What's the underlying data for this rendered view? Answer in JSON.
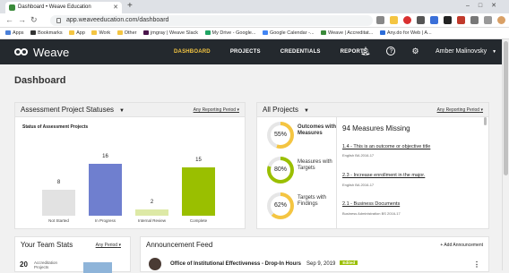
{
  "browser": {
    "tab_title": "Dashboard • Weave Education",
    "url": "app.weaveeducation.com/dashboard",
    "bookmarks": [
      "Apps",
      "Bookmarks",
      "App",
      "Work",
      "Other",
      "jmgray | Weave Slack",
      "My Drive - Google...",
      "Google Calendar -...",
      "Weave | Accreditat...",
      "Any.do for Web | A..."
    ]
  },
  "nav": {
    "logo": "Weave",
    "links": [
      "DASHBOARD",
      "PROJECTS",
      "CREDENTIALS",
      "REPORTS"
    ],
    "user": "Amber Malinovsky"
  },
  "page": {
    "title": "Dashboard"
  },
  "statuses_panel": {
    "title": "Assessment Project Statuses",
    "period": "Any Reporting Period",
    "chart_title": "Status of Assessment Projects"
  },
  "chart_data": {
    "type": "bar",
    "title": "Status of Assessment Projects",
    "categories": [
      "Not Started",
      "In Progress",
      "Internal Review",
      "Complete"
    ],
    "values": [
      8,
      16,
      2,
      15
    ],
    "colors": [
      "#e2e2e2",
      "#6f7fcf",
      "#dde9a6",
      "#9abf00"
    ]
  },
  "projects_panel": {
    "title": "All Projects",
    "period": "Any Reporting Period",
    "outcomes": [
      {
        "pct": "55%",
        "label": "Outcomes with Measures",
        "value": 0.55,
        "color": "#f4c542"
      },
      {
        "pct": "80%",
        "label": "Measures with Targets",
        "value": 0.8,
        "color": "#9abf00"
      },
      {
        "pct": "62%",
        "label": "Targets with Findings",
        "value": 0.62,
        "color": "#f4c542"
      }
    ],
    "missing_title": "94 Measures Missing",
    "missing": [
      {
        "link": "1.4 - This is an outcome or objective title",
        "sub": "English BA 2016-17"
      },
      {
        "link": "2.3 - Increase enrollment in the major.",
        "sub": "English BA 2016-17"
      },
      {
        "link": "2.1 - Business Documents",
        "sub": "Business Administration BS 2016-17"
      }
    ]
  },
  "team_panel": {
    "title": "Your Team Stats",
    "period": "Any Period",
    "stat_value": "20",
    "stat_label": "Accreditation Projects"
  },
  "feed_panel": {
    "title": "Announcement Feed",
    "add_label": "+ Add Announcement",
    "item_title": "Office of Institutional Effectiveness - Drop-In Hours",
    "item_date": "Sep 9, 2019",
    "item_tag": "Edited"
  }
}
